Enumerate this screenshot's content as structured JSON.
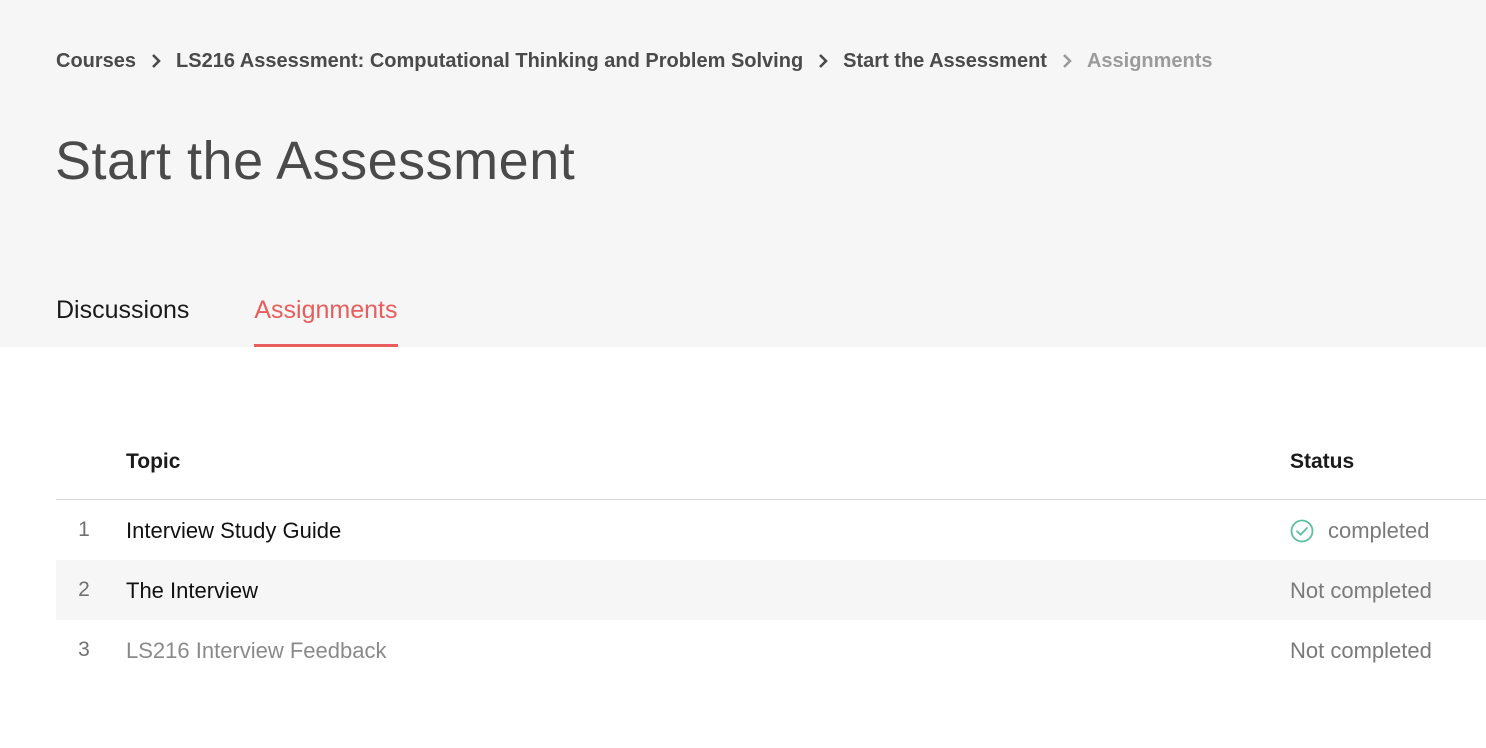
{
  "breadcrumb": {
    "items": [
      "Courses",
      "LS216 Assessment: Computational Thinking and Problem Solving",
      "Start the Assessment",
      "Assignments"
    ]
  },
  "page": {
    "title": "Start the Assessment"
  },
  "tabs": [
    {
      "label": "Discussions",
      "active": false
    },
    {
      "label": "Assignments",
      "active": true
    }
  ],
  "table": {
    "headers": {
      "topic": "Topic",
      "status": "Status"
    },
    "rows": [
      {
        "number": "1",
        "topic": "Interview Study Guide",
        "status": "completed",
        "status_icon": "check-circle-icon"
      },
      {
        "number": "2",
        "topic": "The Interview",
        "status": "Not completed"
      },
      {
        "number": "3",
        "topic": "LS216 Interview Feedback",
        "status": "Not completed"
      }
    ]
  },
  "colors": {
    "accent": "#e85d5d",
    "completed_icon": "#5cbf9f",
    "header_bg": "#f6f6f6"
  }
}
